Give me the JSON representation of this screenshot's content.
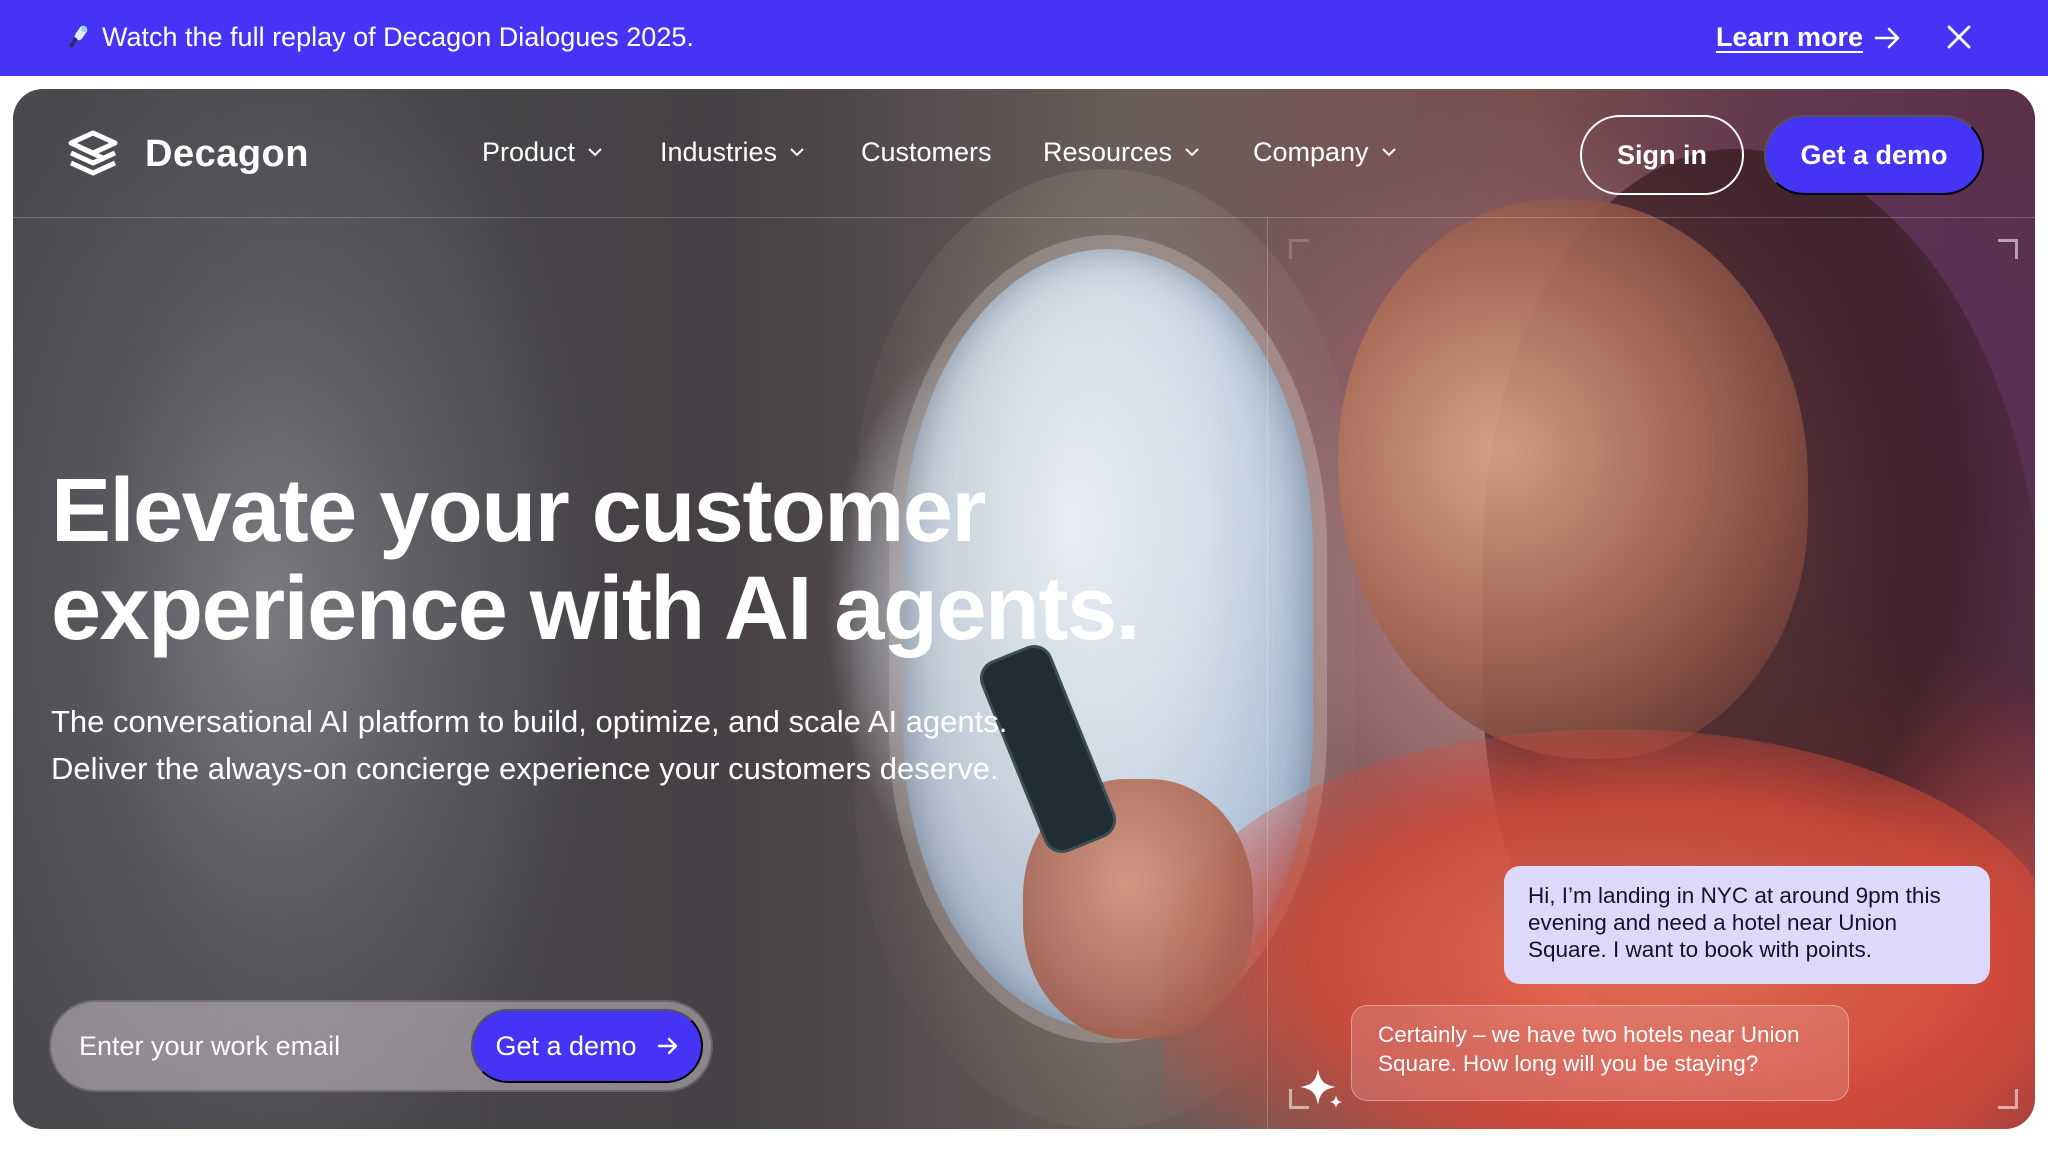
{
  "banner": {
    "text": "Watch the full replay of Decagon Dialogues 2025.",
    "link_label": "Learn more",
    "icon": "microphone-icon",
    "background": "#4534f5"
  },
  "nav": {
    "brand": "Decagon",
    "items": [
      {
        "label": "Product",
        "has_dropdown": true
      },
      {
        "label": "Industries",
        "has_dropdown": true
      },
      {
        "label": "Customers",
        "has_dropdown": false
      },
      {
        "label": "Resources",
        "has_dropdown": true
      },
      {
        "label": "Company",
        "has_dropdown": true
      }
    ],
    "sign_in_label": "Sign in",
    "demo_label": "Get a demo"
  },
  "hero": {
    "headline_line1": "Elevate your customer",
    "headline_line2": "experience with AI agents.",
    "subhead_line1": "The conversational AI platform to build, optimize, and scale AI agents.",
    "subhead_line2": "Deliver the always-on concierge experience your customers deserve.",
    "email_placeholder": "Enter your work email",
    "cta_label": "Get a demo"
  },
  "chat": {
    "user_message": "Hi, I’m landing in NYC at around 9pm this evening and need a hotel near Union Square. I want to book with points.",
    "agent_message": "Certainly – we have two hotels near Union Square. How long will you be staying?"
  },
  "colors": {
    "accent": "#4534f5",
    "user_bubble": "#dcd9fb"
  }
}
